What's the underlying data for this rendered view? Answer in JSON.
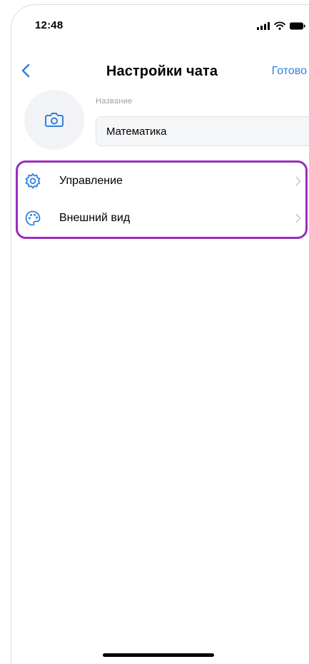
{
  "status_bar": {
    "time": "12:48"
  },
  "nav": {
    "title": "Настройки чата",
    "done_label": "Готово"
  },
  "chat_name": {
    "label": "Название",
    "value": "Математика"
  },
  "menu": {
    "items": [
      {
        "label": "Управление",
        "icon": "gear-icon"
      },
      {
        "label": "Внешний вид",
        "icon": "palette-icon"
      }
    ]
  },
  "colors": {
    "accent": "#2d81e0",
    "highlight": "#9c2bbf",
    "field_bg": "#f5f6f8",
    "avatar_bg": "#f1f3f6"
  }
}
